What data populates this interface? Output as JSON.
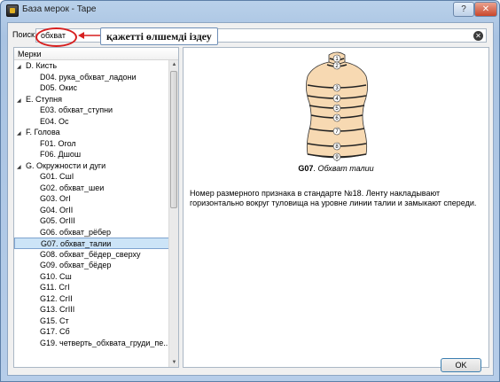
{
  "window": {
    "title": "База мерок - Tape"
  },
  "titlebar": {
    "help_label": "?",
    "close_label": "✕"
  },
  "search": {
    "label": "Поиск:",
    "value": "обхват",
    "clear_icon": "clear-icon"
  },
  "annotation": {
    "text": "қажетті өлшемді іздеу",
    "color": "#d71f1f"
  },
  "tree": {
    "header": "Мерки",
    "rows": [
      {
        "type": "group",
        "text": "D. Кисть"
      },
      {
        "type": "leaf",
        "text": "D04. рука_обхват_ладони"
      },
      {
        "type": "leaf",
        "text": "D05. Окис"
      },
      {
        "type": "group",
        "text": "E. Ступня"
      },
      {
        "type": "leaf",
        "text": "E03. обхват_ступни"
      },
      {
        "type": "leaf",
        "text": "E04. Ос"
      },
      {
        "type": "group",
        "text": "F. Голова"
      },
      {
        "type": "leaf",
        "text": "F01. Огол"
      },
      {
        "type": "leaf",
        "text": "F06. Дшош"
      },
      {
        "type": "group",
        "text": "G. Окружности и дуги"
      },
      {
        "type": "leaf",
        "text": "G01. СшI"
      },
      {
        "type": "leaf",
        "text": "G02. обхват_шеи"
      },
      {
        "type": "leaf",
        "text": "G03. ОгI"
      },
      {
        "type": "leaf",
        "text": "G04. ОгII"
      },
      {
        "type": "leaf",
        "text": "G05. ОгIII"
      },
      {
        "type": "leaf",
        "text": "G06. обхват_рёбер"
      },
      {
        "type": "leaf",
        "text": "G07. обхват_талии",
        "selected": true
      },
      {
        "type": "leaf",
        "text": "G08. обхват_бёдер_сверху"
      },
      {
        "type": "leaf",
        "text": "G09. обхват_бёдер"
      },
      {
        "type": "leaf",
        "text": "G10. Сш"
      },
      {
        "type": "leaf",
        "text": "G11. СгI"
      },
      {
        "type": "leaf",
        "text": "G12. СгII"
      },
      {
        "type": "leaf",
        "text": "G13. СгIII"
      },
      {
        "type": "leaf",
        "text": "G15. Ст"
      },
      {
        "type": "leaf",
        "text": "G17. Сб"
      },
      {
        "type": "leaf",
        "text": "G19. четверть_обхвата_груди_пе..."
      }
    ]
  },
  "detail": {
    "figure_labels": [
      "1",
      "2",
      "3",
      "4",
      "5",
      "6",
      "7",
      "8",
      "9"
    ],
    "caption_code": "G07",
    "caption_sep": ".",
    "caption_name": "Обхват талии",
    "description": "Номер размерного признака в стандарте №18. Ленту накладывают горизонтально вокруг туловища на уровне линии талии и замыкают спереди."
  },
  "buttons": {
    "ok": "OK"
  }
}
